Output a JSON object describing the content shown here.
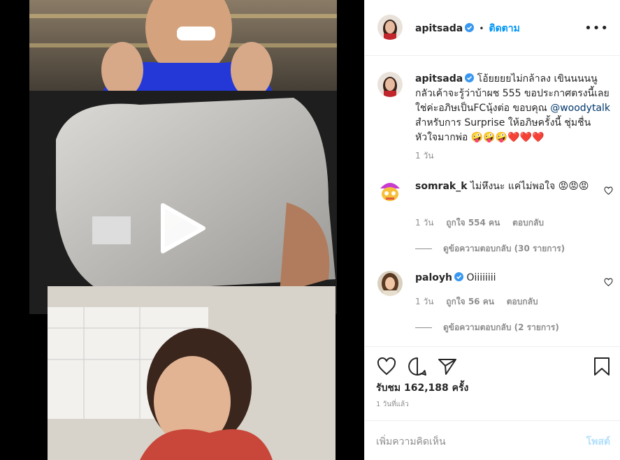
{
  "post": {
    "username": "apitsada",
    "follow_label": "ติดตาม",
    "separator": "•",
    "more_icon": "more-horizontal-icon"
  },
  "caption": {
    "username": "apitsada",
    "text_before_mention": "โอ้ยยยยไม่กล้าลง เขินนนนนูกลัวเค้าจะรู้ว่าบ้าผช 555 ขอประกาศตรงนี้เลย ใช่ค่ะอภิษเป็นFCนุ้งต่อ ขอบคุณ ",
    "mention": "@woodytalk",
    "text_after_mention": " สำหรับการ Surprise ให้อภิษครั้งนี้ ชุ่มชื่นหัวใจมากพ่อ 🤪🤪🤪❤️❤️❤️",
    "time": "1 วัน"
  },
  "comments": [
    {
      "username": "somrak_k",
      "text": "ไม่หึงนะ แค่ไม่พอใจ 😡😡😡",
      "time": "1 วัน",
      "likes": "ถูกใจ 554 คน",
      "reply_label": "ตอบกลับ",
      "view_replies": "ดูข้อความตอบกลับ (30 รายการ)"
    },
    {
      "username": "paloyh",
      "text": "Oiiiiiiii",
      "time": "1 วัน",
      "likes": "ถูกใจ 56 คน",
      "reply_label": "ตอบกลับ",
      "view_replies": "ดูข้อความตอบกลับ (2 รายการ)"
    }
  ],
  "stats": {
    "views": "รับชม 162,188 ครั้ง",
    "timestamp": "1 วันที่แล้ว"
  },
  "add_comment": {
    "placeholder": "เพิ่มความคิดเห็น",
    "post_label": "โพสต์"
  },
  "colors": {
    "accent_blue": "#0095f6",
    "muted_gray": "#8e8e8e",
    "text_dark": "#262626",
    "post_disabled": "#b2dffc"
  }
}
